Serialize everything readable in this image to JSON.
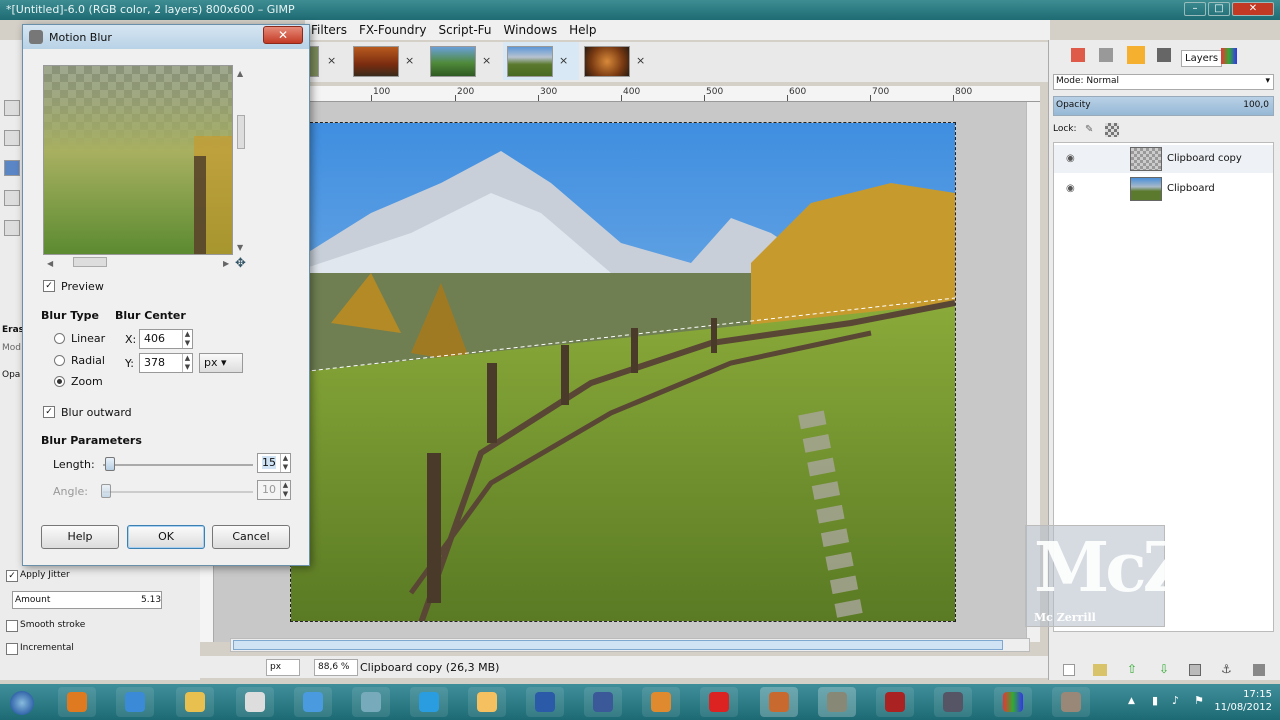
{
  "window": {
    "title": "*[Untitled]-6.0 (RGB color, 2 layers) 800x600 – GIMP"
  },
  "menu": [
    "Filters",
    "FX-Foundry",
    "Script-Fu",
    "Windows",
    "Help"
  ],
  "tabs": [
    {
      "close": "×"
    },
    {
      "close": "×"
    },
    {
      "close": "×"
    },
    {
      "close": "×"
    },
    {
      "close": "×"
    }
  ],
  "ruler": {
    "labels": [
      "100",
      "200",
      "300",
      "400",
      "500",
      "600",
      "700",
      "800"
    ]
  },
  "dialog": {
    "title": "Motion Blur",
    "close": "✕",
    "preview_label": "Preview",
    "blur_type": {
      "label": "Blur Type",
      "options": [
        "Linear",
        "Radial",
        "Zoom"
      ],
      "selected": "Zoom"
    },
    "blur_center": {
      "label": "Blur Center",
      "x_label": "X:",
      "x_value": "406",
      "y_label": "Y:",
      "y_value": "378",
      "unit": "px"
    },
    "blur_outward": {
      "label": "Blur outward",
      "checked": true
    },
    "blur_parameters": {
      "label": "Blur Parameters",
      "length_label": "Length:",
      "length_value": "15",
      "angle_label": "Angle:",
      "angle_value": "10"
    },
    "buttons": {
      "help": "Help",
      "ok": "OK",
      "cancel": "Cancel"
    }
  },
  "toolbox": {
    "erase_label": "Erase",
    "mode_label": "Mod",
    "opacity_label": "Opa",
    "apply_jitter": "Apply Jitter",
    "amount_label": "Amount",
    "amount_value": "5.13",
    "smooth_stroke": "Smooth stroke",
    "incremental": "Incremental"
  },
  "layers_panel": {
    "tab_label": "Layers",
    "mode_label": "Mode: Normal",
    "opacity_label": "Opacity",
    "opacity_value": "100,0",
    "lock_label": "Lock:",
    "layers": [
      {
        "name": "Clipboard copy",
        "visible": true
      },
      {
        "name": "Clipboard",
        "visible": true
      }
    ]
  },
  "status": {
    "unit": "px",
    "zoom": "88,6 %",
    "info": "Clipboard copy (26,3 MB)"
  },
  "watermark": {
    "big": "McZ",
    "small": "Mc Zerrill"
  },
  "taskbar": {
    "time": "17:15",
    "date": "11/08/2012"
  },
  "colors": {
    "taskbar": "#1d6a74",
    "dialog_title": "#b8d2e6",
    "close_button": "#c33a24",
    "selection_blue": "#cfe3f5"
  }
}
